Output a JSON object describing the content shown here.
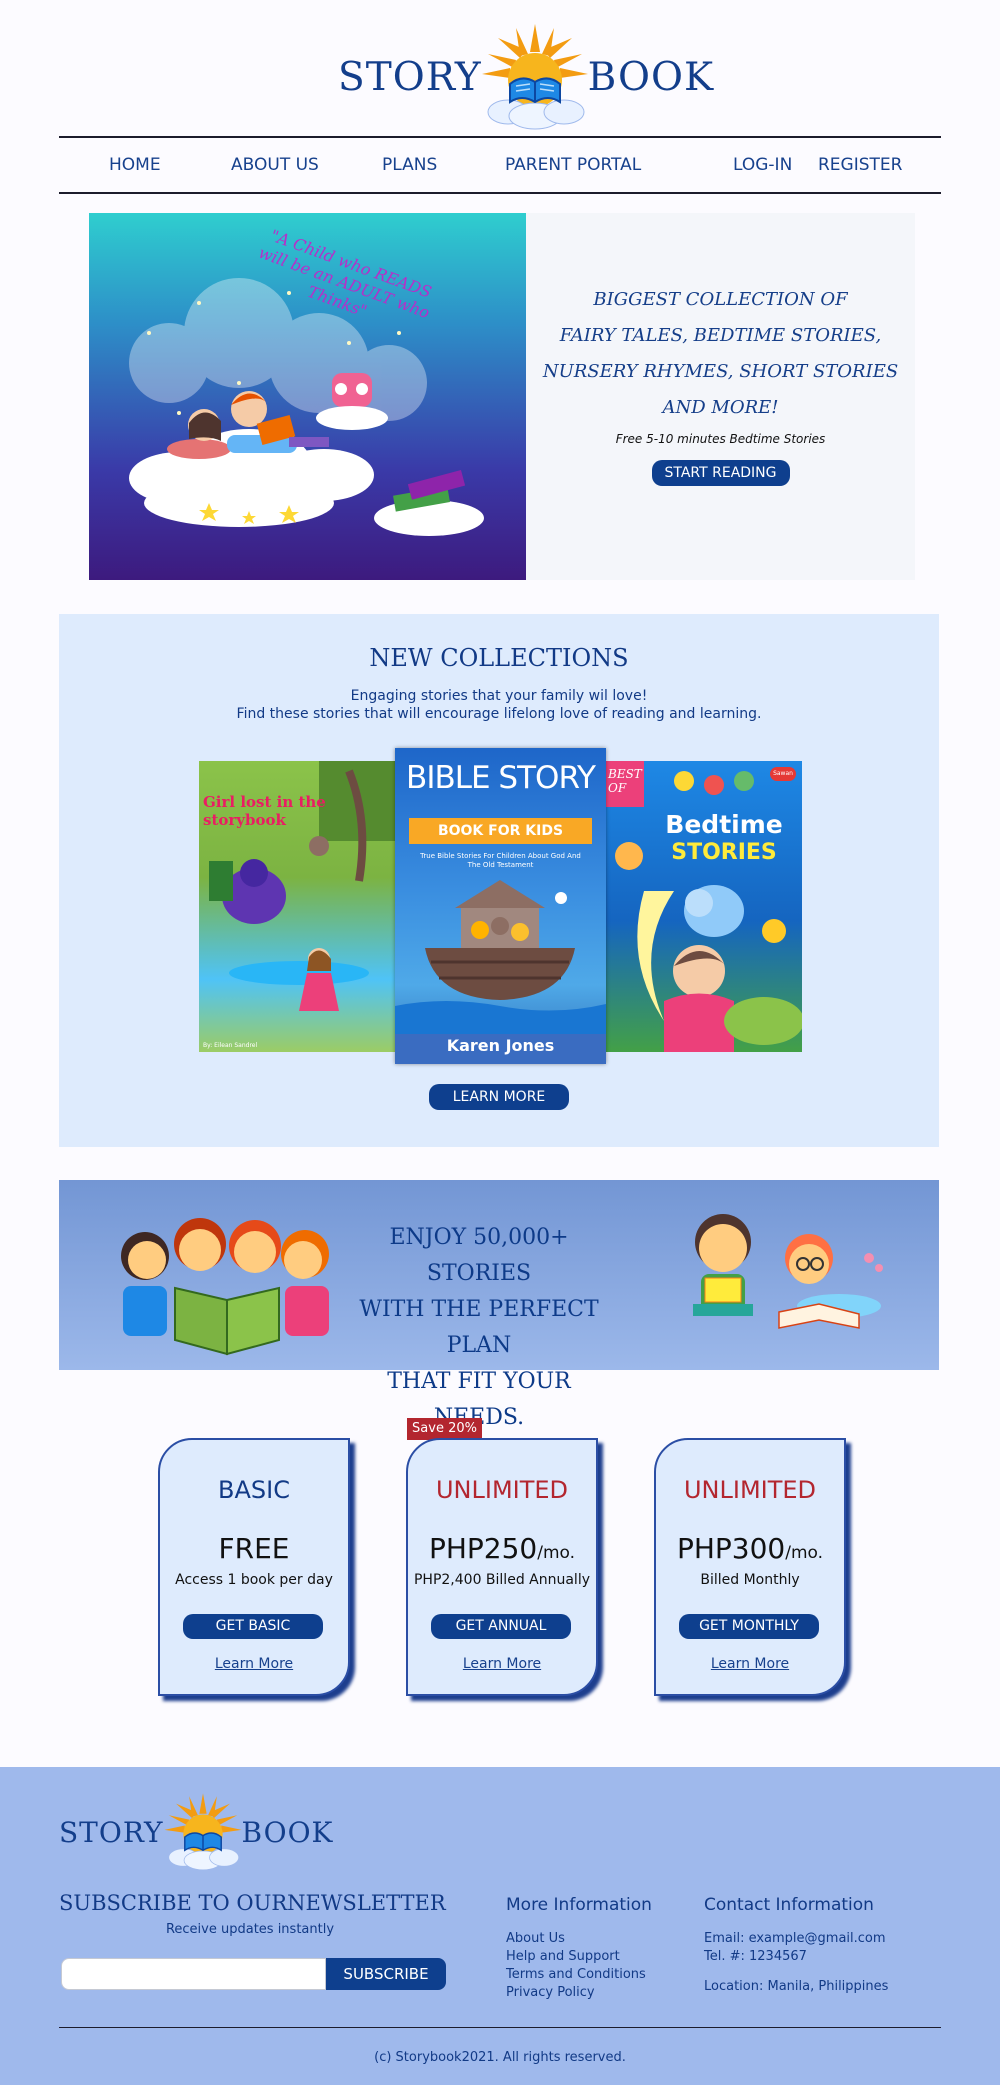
{
  "brand": {
    "left": "STORY",
    "right": "BOOK"
  },
  "nav": {
    "home": "HOME",
    "about": "ABOUT US",
    "plans": "PLANS",
    "parent": "PARENT PORTAL",
    "login": "LOG-IN",
    "register": "REGISTER"
  },
  "hero": {
    "quote": "\"A Child who READS will be an ADULT who Thinks\"",
    "lines": [
      "BIGGEST COLLECTION OF",
      "FAIRY TALES, BEDTIME STORIES,",
      "NURSERY RHYMES, SHORT STORIES",
      "AND MORE!"
    ],
    "sub": "Free 5-10 minutes Bedtime Stories",
    "cta": "START READING"
  },
  "collections": {
    "title": "NEW COLLECTIONS",
    "desc1": "Engaging stories that your family wil love!",
    "desc2": "Find these stories that will encourage lifelong love of reading and learning.",
    "books": [
      {
        "title1": "Girl lost in the",
        "title2": "storybook",
        "author": "By: Eilean Sandrel"
      },
      {
        "title": "BIBLE STORY",
        "ribbon": "BOOK FOR KIDS",
        "tag": "True Bible Stories For Children About God And The Old Testament",
        "author": "Karen Jones"
      },
      {
        "top1": "BEST",
        "top2": "OF",
        "title1": "Bedtime",
        "title2": "STORIES",
        "seal": "Sawan"
      }
    ],
    "cta": "LEARN MORE"
  },
  "banner": {
    "line1": "ENJOY 50,000+ STORIES",
    "line2": "WITH THE PERFECT PLAN",
    "line3": "THAT FIT YOUR NEEDS."
  },
  "plans": {
    "save_badge": "Save 20%",
    "items": [
      {
        "name": "BASIC",
        "price": "FREE",
        "unit": "",
        "desc": "Access 1 book per day",
        "cta": "GET BASIC",
        "link": "Learn More"
      },
      {
        "name": "UNLIMITED",
        "price": "PHP250",
        "unit": "/mo.",
        "desc": "PHP2,400 Billed Annually",
        "cta": "GET ANNUAL",
        "link": "Learn More"
      },
      {
        "name": "UNLIMITED",
        "price": "PHP300",
        "unit": "/mo.",
        "desc": "Billed Monthly",
        "cta": "GET MONTHLY",
        "link": "Learn More"
      }
    ]
  },
  "footer": {
    "subscribe_title": "SUBSCRIBE TO OURNEWSLETTER",
    "subscribe_note": "Receive updates instantly",
    "subscribe_value": "",
    "subscribe_button": "SUBSCRIBE",
    "more_title": "More Information",
    "more_links": [
      "About Us",
      "Help and Support",
      "Terms and Conditions",
      "Privacy Policy"
    ],
    "contact_title": "Contact Information",
    "email": "Email: example@gmail.com",
    "tel": "Tel. #: 1234567",
    "location": "Location: Manila, Philippines",
    "copyright": "(c) Storybook2021. All rights reserved."
  },
  "colors": {
    "primary": "#0e3f8e",
    "accent_red": "#b3262f",
    "footer_bg": "#9fb9ec",
    "collections_bg": "#deebfd"
  }
}
